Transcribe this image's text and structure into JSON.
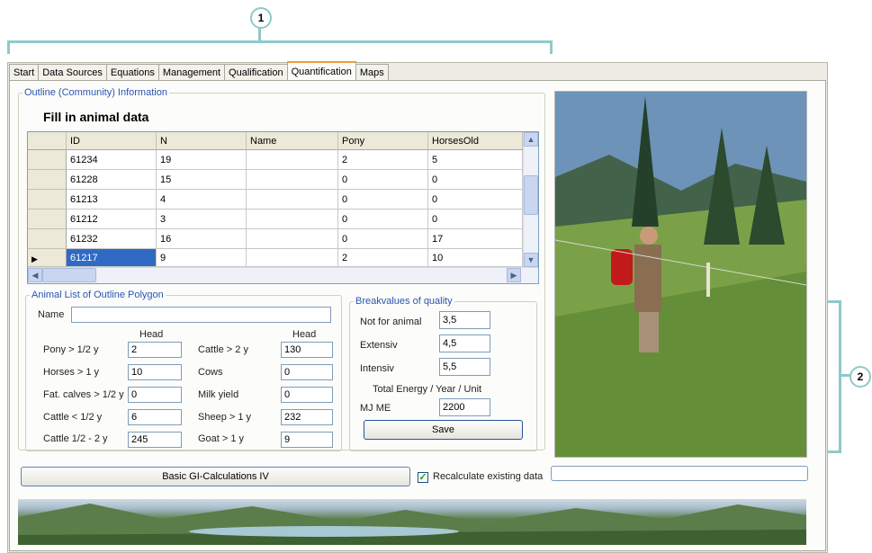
{
  "callouts": [
    "1",
    "2"
  ],
  "tabs": [
    "Start",
    "Data Sources",
    "Equations",
    "Management",
    "Qualification",
    "Quantification",
    "Maps"
  ],
  "active_tab": "Quantification",
  "outline": {
    "legend": "Outline (Community) Information",
    "title": "Fill in animal data",
    "columns": [
      "ID",
      "N",
      "Name",
      "Pony",
      "HorsesOld"
    ],
    "rows": [
      [
        "61234",
        "19",
        "",
        "2",
        "5"
      ],
      [
        "61228",
        "15",
        "",
        "0",
        "0"
      ],
      [
        "61213",
        "4",
        "",
        "0",
        "0"
      ],
      [
        "61212",
        "3",
        "",
        "0",
        "0"
      ],
      [
        "61232",
        "16",
        "",
        "0",
        "17"
      ],
      [
        "61217",
        "9",
        "",
        "2",
        "10"
      ]
    ],
    "current_row_marker": "▶"
  },
  "animal_list": {
    "legend": "Animal List of Outline Polygon",
    "name_label": "Name",
    "name_value": "",
    "head_label": "Head",
    "left": [
      {
        "label": "Pony > 1/2 y",
        "value": "2"
      },
      {
        "label": "Horses > 1 y",
        "value": "10"
      },
      {
        "label": "Fat. calves > 1/2 y",
        "value": "0"
      },
      {
        "label": "Cattle < 1/2 y",
        "value": "6"
      },
      {
        "label": "Cattle  1/2 - 2 y",
        "value": "245"
      }
    ],
    "right": [
      {
        "label": "Cattle > 2 y",
        "value": "130"
      },
      {
        "label": "Cows",
        "value": "0"
      },
      {
        "label": "Milk yield",
        "value": "0"
      },
      {
        "label": "Sheep > 1 y",
        "value": "232"
      },
      {
        "label": "Goat > 1 y",
        "value": "9"
      }
    ]
  },
  "breakvalues": {
    "legend": "Breakvalues of quality",
    "items": [
      {
        "label": "Not for animal",
        "value": "3,5"
      },
      {
        "label": "Extensiv",
        "value": "4,5"
      },
      {
        "label": "Intensiv",
        "value": "5,5"
      }
    ],
    "energy_title": "Total Energy  / Year / Unit",
    "energy_label": "MJ ME",
    "energy_value": "2200",
    "save_label": "Save"
  },
  "bottom": {
    "calc_button": "Basic GI-Calculations IV",
    "recalc_label": "Recalculate existing data",
    "recalc_checked": "✓"
  }
}
